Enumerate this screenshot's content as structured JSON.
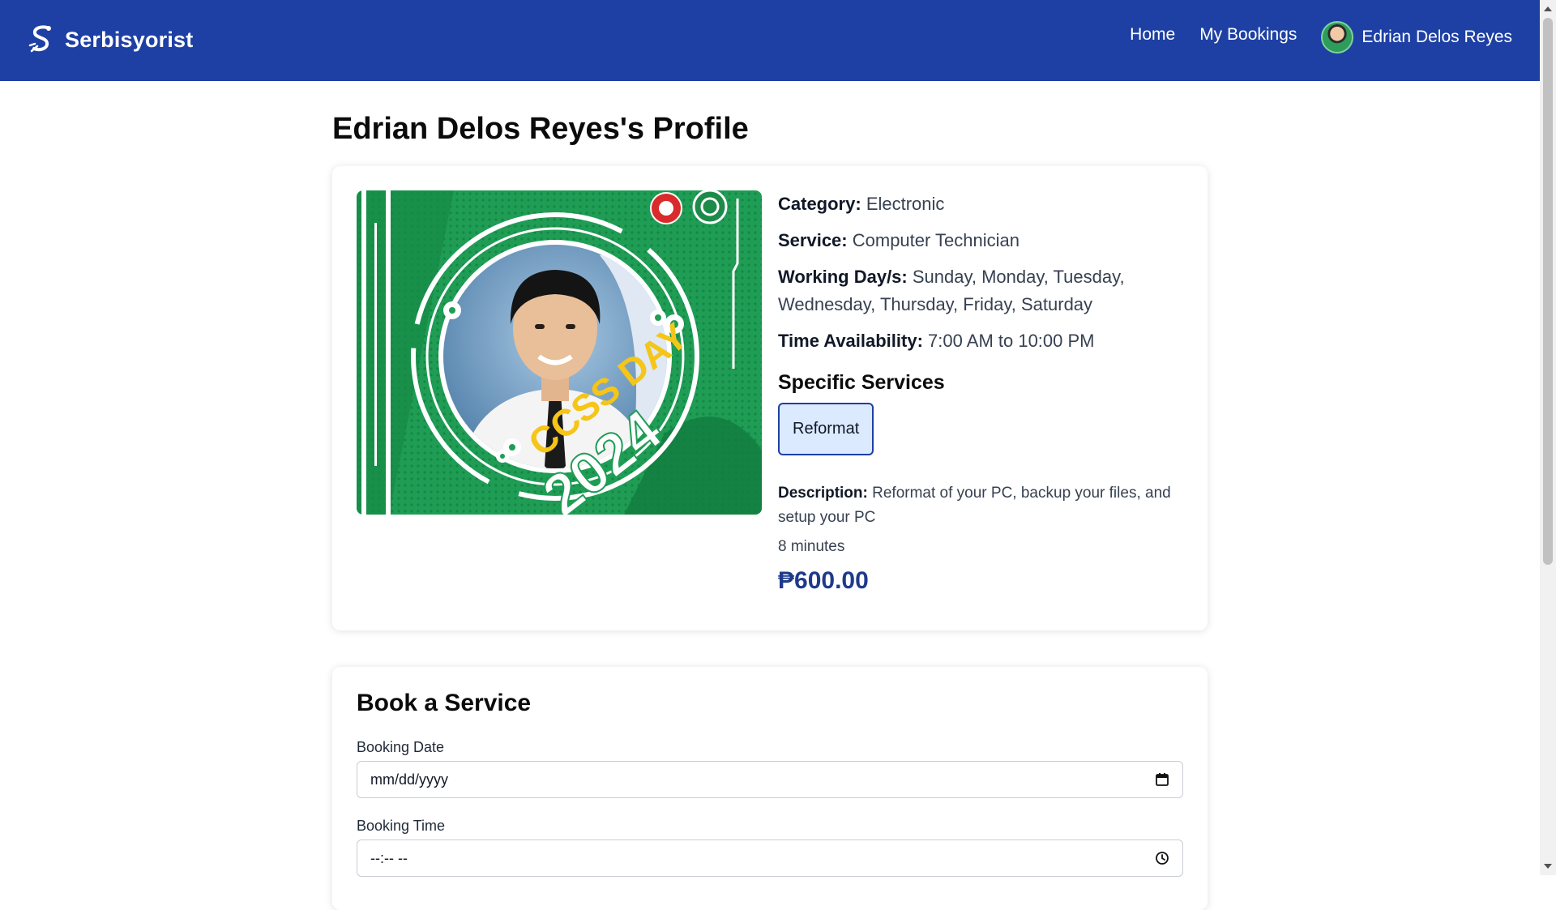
{
  "navbar": {
    "brand": "Serbisyorist",
    "links": [
      "Home",
      "My Bookings"
    ],
    "user_name": "Edrian Delos Reyes"
  },
  "page": {
    "title": "Edrian Delos Reyes's Profile"
  },
  "profile": {
    "photo_banner_text_1": "CCSS DAY",
    "photo_banner_text_2": "2024",
    "category_label": "Category:",
    "category_value": "Electronic",
    "service_label": "Service:",
    "service_value": "Computer Technician",
    "working_days_label": "Working Day/s:",
    "working_days_value": "Sunday, Monday, Tuesday, Wednesday, Thursday, Friday, Saturday",
    "time_label": "Time Availability:",
    "time_value": "7:00 AM to 10:00 PM",
    "specific_services_heading": "Specific Services",
    "selected_service": "Reformat",
    "description_label": "Description:",
    "description_value": "Reformat of your PC, backup your files, and setup your PC",
    "duration": "8 minutes",
    "price": "₱600.00"
  },
  "booking": {
    "title": "Book a Service",
    "date_label": "Booking Date",
    "date_placeholder": "mm/dd/yyyy",
    "time_label": "Booking Time",
    "time_placeholder": "--:-- --"
  },
  "colors": {
    "navbar": "#1e40a4",
    "price": "#1e3a8a",
    "chip_bg": "#dbeafe",
    "photo_green": "#1f9d55",
    "banner_yellow": "#f5c518"
  },
  "icons": [
    "logo-icon",
    "calendar-icon",
    "clock-icon",
    "gear-icon",
    "emblem-icon"
  ]
}
